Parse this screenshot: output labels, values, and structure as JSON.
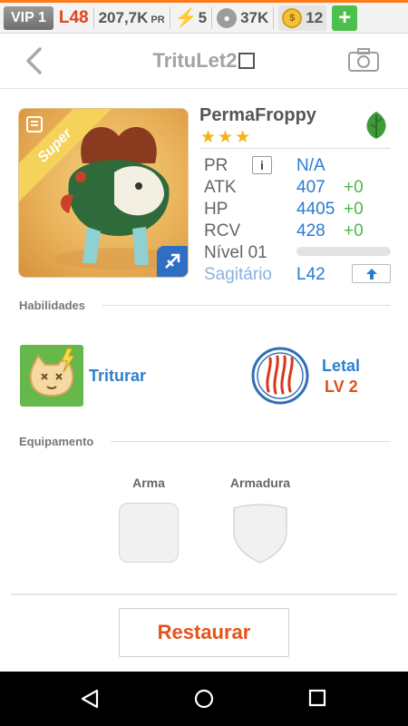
{
  "topbar": {
    "vip": "VIP 1",
    "level": "L48",
    "pr": "207,7K",
    "pr_unit": "PR",
    "energy": "5",
    "paw": "37K",
    "coins": "12",
    "plus": "+"
  },
  "header": {
    "title": "TrituLet2"
  },
  "monster": {
    "name": "PermaFroppy",
    "stars": "★★★",
    "ribbon": "Super",
    "stats": {
      "pr_label": "PR",
      "pr_value": "N/A",
      "info": "i",
      "atk_label": "ATK",
      "atk_value": "407",
      "atk_bonus": "+0",
      "hp_label": "HP",
      "hp_value": "4405",
      "hp_bonus": "+0",
      "rcv_label": "RCV",
      "rcv_value": "428",
      "rcv_bonus": "+0",
      "level_label": "Nível 01",
      "sign_label": "Sagitário",
      "sign_level": "L42",
      "xp_progress": 0
    }
  },
  "skills": {
    "section": "Habilidades",
    "active_name": "Triturar",
    "passive_name": "Letal",
    "passive_level": "LV 2"
  },
  "equipment": {
    "section": "Equipamento",
    "weapon": "Arma",
    "armor": "Armadura"
  },
  "actions": {
    "restore": "Restaurar"
  },
  "colors": {
    "accent": "#e6521a",
    "value_blue": "#2b7ad2",
    "bonus_green": "#4cb847"
  }
}
